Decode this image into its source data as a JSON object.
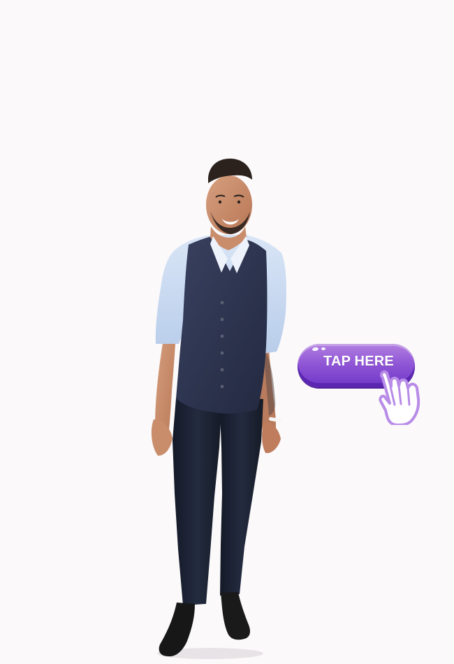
{
  "page": {
    "background": "#fbf9fa"
  },
  "hero_image": {
    "description_name": "person-cutout",
    "colors": {
      "skin": "#c98d6b",
      "hair": "#2b221d",
      "shirt": "#bfd4ef",
      "vest": "#2f3550",
      "pants": "#1a1f2f",
      "shoes": "#161616"
    }
  },
  "cta": {
    "label": "TAP HERE",
    "icon": "pointing-hand-icon",
    "colors": {
      "button_top": "#b27fe0",
      "button_mid": "#9157d6",
      "button_bottom": "#6f36c8",
      "hand_outline": "#b88ce7",
      "hand_fill": "#ffffff"
    }
  }
}
